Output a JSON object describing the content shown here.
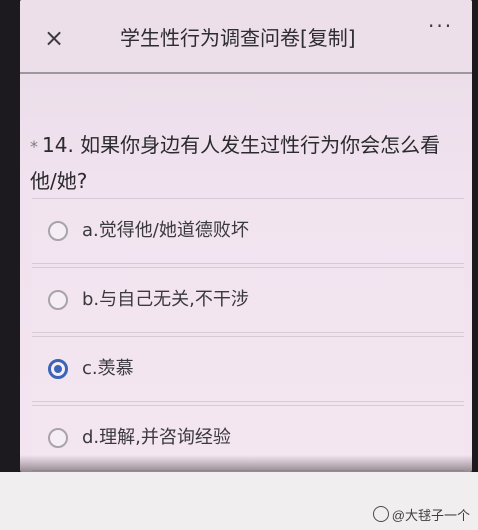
{
  "header": {
    "close_label": "×",
    "title": "学生性行为调查问卷[复制]",
    "more_label": "···"
  },
  "question": {
    "required_mark": "*",
    "text": "14. 如果你身边有人发生过性行为你会怎么看他/她?"
  },
  "options": [
    {
      "label": "a.觉得他/她道德败坏",
      "selected": false
    },
    {
      "label": "b.与自己无关,不干涉",
      "selected": false
    },
    {
      "label": "c.羡慕",
      "selected": true
    },
    {
      "label": "d.理解,并咨询经验",
      "selected": false
    }
  ],
  "watermark": {
    "icon": "weibo-icon",
    "text": "@大毬子一个"
  },
  "colors": {
    "accent": "#3b63b7",
    "background": "#f0e2ee"
  }
}
